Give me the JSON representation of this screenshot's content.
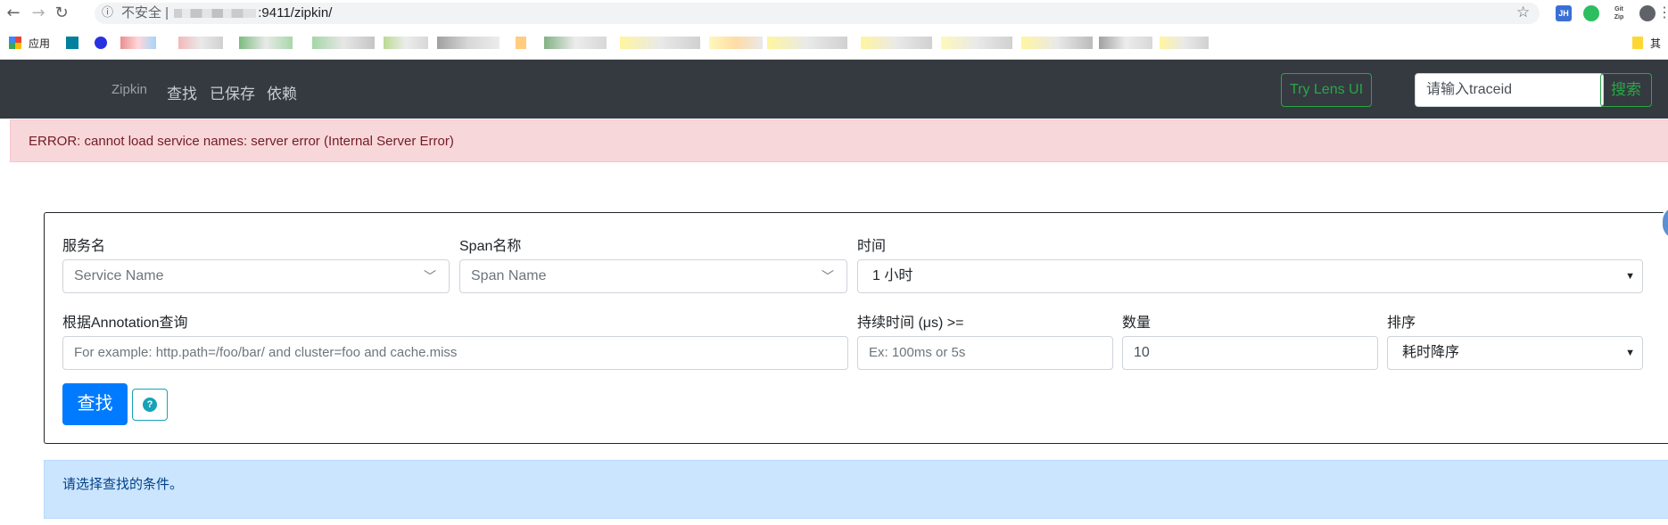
{
  "browser": {
    "url_insecure": "不安全 |",
    "url_port_path": ":9411/zipkin/",
    "extensions": [
      {
        "name": "jh-extension-icon",
        "text": "JH",
        "color": "#3b6fd6"
      },
      {
        "name": "evernote-icon",
        "text": "",
        "color": "#2dbe60"
      },
      {
        "name": "gitzip-icon",
        "text": "Git Zip",
        "color": "#444444"
      }
    ],
    "bookmarks_app_label": "应用",
    "bookmarks_other_label": "其"
  },
  "navbar": {
    "brand": "Zipkin",
    "links": [
      "查找",
      "已保存",
      "依赖"
    ],
    "lens_button": "Try Lens UI",
    "traceid_placeholder": "请输入traceid",
    "search_button": "搜索"
  },
  "error_alert": "ERROR: cannot load service names: server error (Internal Server Error)",
  "form": {
    "service_label": "服务名",
    "service_placeholder": "Service Name",
    "span_label": "Span名称",
    "span_placeholder": "Span Name",
    "time_label": "时间",
    "time_value": "1 小时",
    "annotation_label": "根据Annotation查询",
    "annotation_placeholder": "For example: http.path=/foo/bar/ and cluster=foo and cache.miss",
    "duration_label": "持续时间 (μs) >=",
    "duration_placeholder": "Ex: 100ms or 5s",
    "limit_label": "数量",
    "limit_value": "10",
    "sort_label": "排序",
    "sort_value": "耗时降序",
    "find_button": "查找",
    "help_icon": "?"
  },
  "info_alert": "请选择查找的条件。"
}
